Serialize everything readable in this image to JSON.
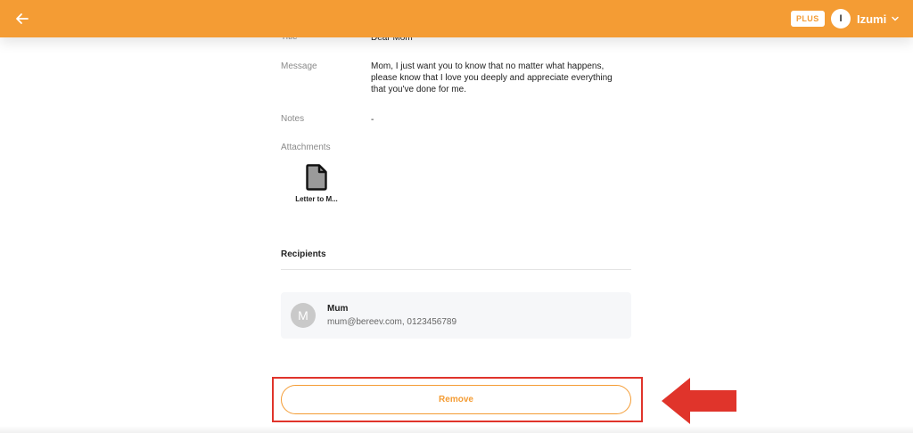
{
  "header": {
    "back_icon": "arrow-left-icon",
    "plus_label": "PLUS",
    "user_initial": "I",
    "user_name": "Izumi",
    "menu_icon": "chevron-down-icon",
    "bar_color": "#f49c34"
  },
  "message": {
    "title_label": "Title",
    "title_value": "Dear Mom",
    "message_label": "Message",
    "message_lines": [
      "Mom, I just want you to know that no matter what happens,",
      "please know that I love you deeply and appreciate everything",
      "that you've done for me."
    ],
    "notes_label": "Notes",
    "notes_value": "-",
    "attachments_label": "Attachments",
    "attachments": [
      {
        "name": "Letter to M...",
        "icon": "document-icon"
      }
    ]
  },
  "recipients": {
    "title": "Recipients",
    "items": [
      {
        "initial": "M",
        "name": "Mum",
        "contact": "mum@bereev.com, 0123456789"
      }
    ]
  },
  "actions": {
    "remove_label": "Remove",
    "accent_color": "#f49c34",
    "highlight_color": "#e0342b"
  }
}
